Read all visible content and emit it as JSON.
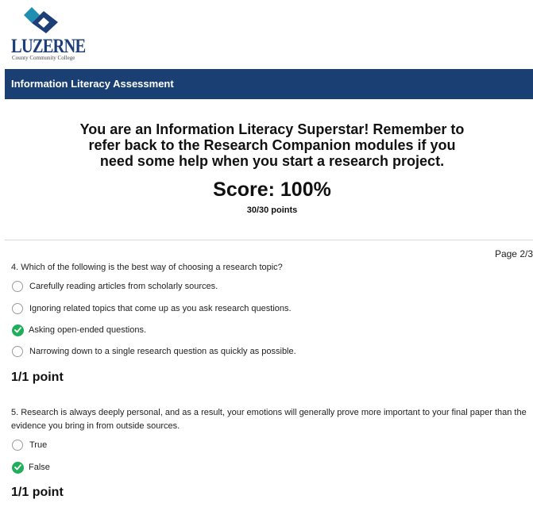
{
  "logo": {
    "wordmark": "LUZERNE",
    "subtitle": "County Community College",
    "colors": {
      "navy": "#1c3f78",
      "teal": "#1f8fb1"
    }
  },
  "header": {
    "title": "Information Literacy Assessment",
    "background": "#1a4073"
  },
  "result": {
    "message": "You are an Information Literacy Superstar! Remember to refer back to the Research Companion modules if you need some help when you start a research project.",
    "score": "Score: 100%",
    "points": "30/30 points"
  },
  "page_indicator": "Page 2/3",
  "questions": [
    {
      "text": "4. Which of the following is the best way of choosing a research topic?",
      "options": [
        {
          "label": "Carefully reading articles from scholarly sources.",
          "selected": false,
          "icon": "radio-empty-icon"
        },
        {
          "label": "Ignoring related topics that come up as you ask research questions.",
          "selected": false,
          "icon": "radio-empty-icon"
        },
        {
          "label": "Asking open-ended questions.",
          "selected": true,
          "icon": "check-circle-icon"
        },
        {
          "label": "Narrowing down to a single research question as quickly as possible.",
          "selected": false,
          "icon": "radio-empty-icon"
        }
      ],
      "points": "1/1 point"
    },
    {
      "text": "5. Research is always deeply personal, and as a result, your emotions will generally prove more important to your final paper than the evidence you bring in from outside sources.",
      "options": [
        {
          "label": "True",
          "selected": false,
          "icon": "radio-empty-icon"
        },
        {
          "label": "False",
          "selected": true,
          "icon": "check-circle-icon"
        }
      ],
      "points": "1/1 point"
    }
  ],
  "colors": {
    "correct": "#1fae5b",
    "radio_border": "#9a9a9a"
  }
}
